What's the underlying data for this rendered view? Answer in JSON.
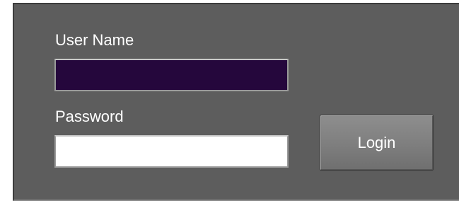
{
  "login_form": {
    "username_label": "User Name",
    "username_value": "",
    "password_label": "Password",
    "password_value": "",
    "login_button_label": "Login"
  },
  "colors": {
    "panel_background": "#5d5d5d",
    "username_field_background": "#25073c",
    "password_field_background": "#ffffff",
    "text": "#ffffff"
  }
}
